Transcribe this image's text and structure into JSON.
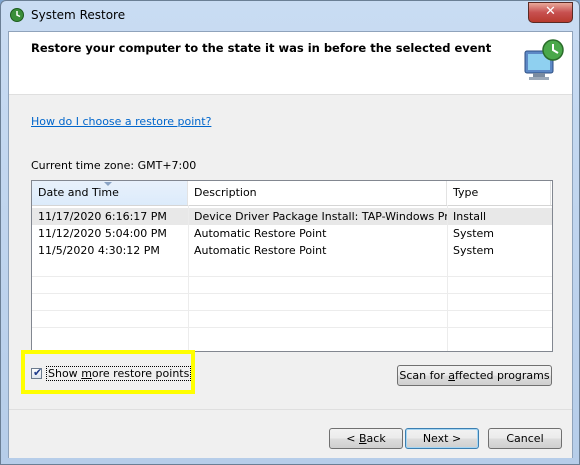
{
  "window": {
    "title": "System Restore",
    "close_label": "✕"
  },
  "header": {
    "text": "Restore your computer to the state it was in before the selected event",
    "icon": "system-restore-computer-icon"
  },
  "help_link": "How do I choose a restore point?",
  "timezone": "Current time zone: GMT+7:00",
  "table": {
    "columns": [
      "Date and Time",
      "Description",
      "Type"
    ],
    "rows": [
      {
        "date": "11/17/2020 6:16:17 PM",
        "description": "Device Driver Package Install: TAP-Windows Pro...",
        "type": "Install"
      },
      {
        "date": "11/12/2020 5:04:00 PM",
        "description": "Automatic Restore Point",
        "type": "System"
      },
      {
        "date": "11/5/2020 4:30:12 PM",
        "description": "Automatic Restore Point",
        "type": "System"
      }
    ]
  },
  "checkbox": {
    "label_pre": "Show ",
    "label_accel": "m",
    "label_post": "ore restore points",
    "checked": true
  },
  "scan_button": {
    "pre": "Scan for ",
    "accel": "a",
    "post": "ffected programs"
  },
  "buttons": {
    "back_pre": "< ",
    "back_accel": "B",
    "back_post": "ack",
    "next": "Next >",
    "cancel": "Cancel"
  },
  "colors": {
    "highlight": "#ffff00",
    "link": "#0066cc"
  }
}
